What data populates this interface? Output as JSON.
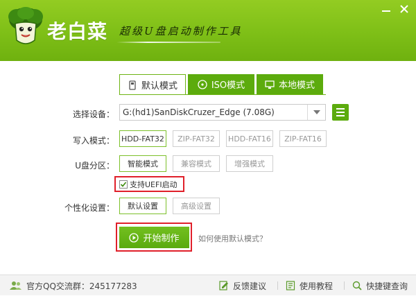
{
  "header": {
    "brand": "老白菜",
    "slogan": "超级U盘启动制作工具"
  },
  "tabs": [
    {
      "label": "默认模式",
      "icon": "usb-drive-icon",
      "active": true
    },
    {
      "label": "ISO模式",
      "icon": "disc-icon",
      "active": false
    },
    {
      "label": "本地模式",
      "icon": "monitor-icon",
      "active": false
    }
  ],
  "device": {
    "label": "选择设备：",
    "value": "G:(hd1)SanDiskCruzer_Edge (7.08G)"
  },
  "write_mode": {
    "label": "写入模式：",
    "options": [
      "HDD-FAT32",
      "ZIP-FAT32",
      "HDD-FAT16",
      "ZIP-FAT16"
    ],
    "selected": "HDD-FAT32"
  },
  "partition": {
    "label": "U盘分区：",
    "options": [
      "智能模式",
      "兼容模式",
      "增强模式"
    ],
    "selected": "智能模式"
  },
  "uefi": {
    "label": "支持UEFI启动",
    "checked": true
  },
  "personalize": {
    "label": "个性化设置：",
    "options": [
      "默认设置",
      "高级设置"
    ],
    "selected": "默认设置"
  },
  "start_button": {
    "label": "开始制作"
  },
  "help_link": "如何使用默认模式？",
  "footer": {
    "qq_group": "官方QQ交流群：245177283",
    "feedback": "反馈建议",
    "tutorial": "使用教程",
    "shortcut": "快捷键查询"
  },
  "colors": {
    "brand_green": "#7ebf17",
    "tab_green": "#5cab0d",
    "highlight_red": "#e0202a"
  }
}
